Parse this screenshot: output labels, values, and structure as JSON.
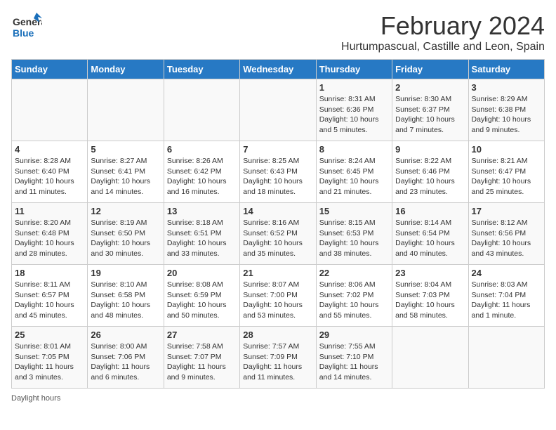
{
  "header": {
    "logo_general": "General",
    "logo_blue": "Blue",
    "month_title": "February 2024",
    "subtitle": "Hurtumpascual, Castille and Leon, Spain"
  },
  "days_of_week": [
    "Sunday",
    "Monday",
    "Tuesday",
    "Wednesday",
    "Thursday",
    "Friday",
    "Saturday"
  ],
  "weeks": [
    [
      {
        "day": "",
        "info": ""
      },
      {
        "day": "",
        "info": ""
      },
      {
        "day": "",
        "info": ""
      },
      {
        "day": "",
        "info": ""
      },
      {
        "day": "1",
        "info": "Sunrise: 8:31 AM\nSunset: 6:36 PM\nDaylight: 10 hours\nand 5 minutes."
      },
      {
        "day": "2",
        "info": "Sunrise: 8:30 AM\nSunset: 6:37 PM\nDaylight: 10 hours\nand 7 minutes."
      },
      {
        "day": "3",
        "info": "Sunrise: 8:29 AM\nSunset: 6:38 PM\nDaylight: 10 hours\nand 9 minutes."
      }
    ],
    [
      {
        "day": "4",
        "info": "Sunrise: 8:28 AM\nSunset: 6:40 PM\nDaylight: 10 hours\nand 11 minutes."
      },
      {
        "day": "5",
        "info": "Sunrise: 8:27 AM\nSunset: 6:41 PM\nDaylight: 10 hours\nand 14 minutes."
      },
      {
        "day": "6",
        "info": "Sunrise: 8:26 AM\nSunset: 6:42 PM\nDaylight: 10 hours\nand 16 minutes."
      },
      {
        "day": "7",
        "info": "Sunrise: 8:25 AM\nSunset: 6:43 PM\nDaylight: 10 hours\nand 18 minutes."
      },
      {
        "day": "8",
        "info": "Sunrise: 8:24 AM\nSunset: 6:45 PM\nDaylight: 10 hours\nand 21 minutes."
      },
      {
        "day": "9",
        "info": "Sunrise: 8:22 AM\nSunset: 6:46 PM\nDaylight: 10 hours\nand 23 minutes."
      },
      {
        "day": "10",
        "info": "Sunrise: 8:21 AM\nSunset: 6:47 PM\nDaylight: 10 hours\nand 25 minutes."
      }
    ],
    [
      {
        "day": "11",
        "info": "Sunrise: 8:20 AM\nSunset: 6:48 PM\nDaylight: 10 hours\nand 28 minutes."
      },
      {
        "day": "12",
        "info": "Sunrise: 8:19 AM\nSunset: 6:50 PM\nDaylight: 10 hours\nand 30 minutes."
      },
      {
        "day": "13",
        "info": "Sunrise: 8:18 AM\nSunset: 6:51 PM\nDaylight: 10 hours\nand 33 minutes."
      },
      {
        "day": "14",
        "info": "Sunrise: 8:16 AM\nSunset: 6:52 PM\nDaylight: 10 hours\nand 35 minutes."
      },
      {
        "day": "15",
        "info": "Sunrise: 8:15 AM\nSunset: 6:53 PM\nDaylight: 10 hours\nand 38 minutes."
      },
      {
        "day": "16",
        "info": "Sunrise: 8:14 AM\nSunset: 6:54 PM\nDaylight: 10 hours\nand 40 minutes."
      },
      {
        "day": "17",
        "info": "Sunrise: 8:12 AM\nSunset: 6:56 PM\nDaylight: 10 hours\nand 43 minutes."
      }
    ],
    [
      {
        "day": "18",
        "info": "Sunrise: 8:11 AM\nSunset: 6:57 PM\nDaylight: 10 hours\nand 45 minutes."
      },
      {
        "day": "19",
        "info": "Sunrise: 8:10 AM\nSunset: 6:58 PM\nDaylight: 10 hours\nand 48 minutes."
      },
      {
        "day": "20",
        "info": "Sunrise: 8:08 AM\nSunset: 6:59 PM\nDaylight: 10 hours\nand 50 minutes."
      },
      {
        "day": "21",
        "info": "Sunrise: 8:07 AM\nSunset: 7:00 PM\nDaylight: 10 hours\nand 53 minutes."
      },
      {
        "day": "22",
        "info": "Sunrise: 8:06 AM\nSunset: 7:02 PM\nDaylight: 10 hours\nand 55 minutes."
      },
      {
        "day": "23",
        "info": "Sunrise: 8:04 AM\nSunset: 7:03 PM\nDaylight: 10 hours\nand 58 minutes."
      },
      {
        "day": "24",
        "info": "Sunrise: 8:03 AM\nSunset: 7:04 PM\nDaylight: 11 hours\nand 1 minute."
      }
    ],
    [
      {
        "day": "25",
        "info": "Sunrise: 8:01 AM\nSunset: 7:05 PM\nDaylight: 11 hours\nand 3 minutes."
      },
      {
        "day": "26",
        "info": "Sunrise: 8:00 AM\nSunset: 7:06 PM\nDaylight: 11 hours\nand 6 minutes."
      },
      {
        "day": "27",
        "info": "Sunrise: 7:58 AM\nSunset: 7:07 PM\nDaylight: 11 hours\nand 9 minutes."
      },
      {
        "day": "28",
        "info": "Sunrise: 7:57 AM\nSunset: 7:09 PM\nDaylight: 11 hours\nand 11 minutes."
      },
      {
        "day": "29",
        "info": "Sunrise: 7:55 AM\nSunset: 7:10 PM\nDaylight: 11 hours\nand 14 minutes."
      },
      {
        "day": "",
        "info": ""
      },
      {
        "day": "",
        "info": ""
      }
    ]
  ],
  "footer": {
    "daylight_label": "Daylight hours"
  }
}
